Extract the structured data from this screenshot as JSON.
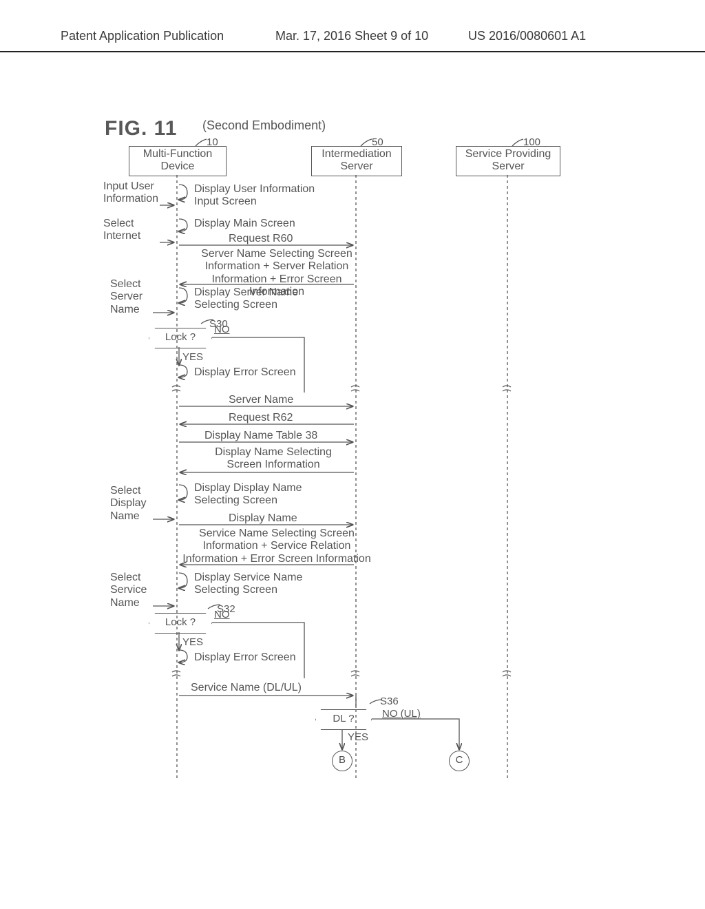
{
  "header": {
    "left": "Patent Application Publication",
    "center": "Mar. 17, 2016  Sheet 9 of 10",
    "right": "US 2016/0080601 A1"
  },
  "fig": {
    "title": "FIG. 11",
    "subtitle": "(Second Embodiment)",
    "refs": {
      "r10": "10",
      "r50": "50",
      "r100": "100"
    },
    "boxes": {
      "mfd": "Multi-Function\nDevice",
      "im": "Intermediation\nServer",
      "sps": "Service Providing\nServer"
    },
    "sidebar": {
      "s1": "Input User\nInformation",
      "s2": "Select\nInternet",
      "s3": "Select\nServer\nName",
      "s4": "Select\nDisplay\nName",
      "s5": "Select\nService\nName"
    },
    "steps": {
      "d1": "Display User Information\nInput Screen",
      "d2": "Display Main Screen",
      "req60": "Request R60",
      "resp60": "Server Name Selecting Screen\nInformation + Server Relation\nInformation + Error Screen Information",
      "d3": "Display Server Name\nSelecting Screen",
      "s30": "S30",
      "lock1": "Lock ?",
      "no1": "NO",
      "yes1": "YES",
      "derr1": "Display Error Screen",
      "sv_name": "Server Name",
      "req62": "Request R62",
      "dnt38": "Display Name Table 38",
      "dns": "Display Name Selecting\nScreen Information",
      "d4": "Display Display Name\nSelecting Screen",
      "disp_name": "Display Name",
      "resp_svc": "Service Name Selecting Screen\nInformation + Service Relation\nInformation + Error Screen Information",
      "d5": "Display Service Name\nSelecting Screen",
      "s32": "S32",
      "lock2": "Lock ?",
      "no2": "NO",
      "yes2": "YES",
      "derr2": "Display Error Screen",
      "svc_name": "Service Name (DL/UL)",
      "s36": "S36",
      "dlq": "DL ?",
      "noul": "NO (UL)",
      "yes3": "YES",
      "B": "B",
      "C": "C"
    }
  }
}
